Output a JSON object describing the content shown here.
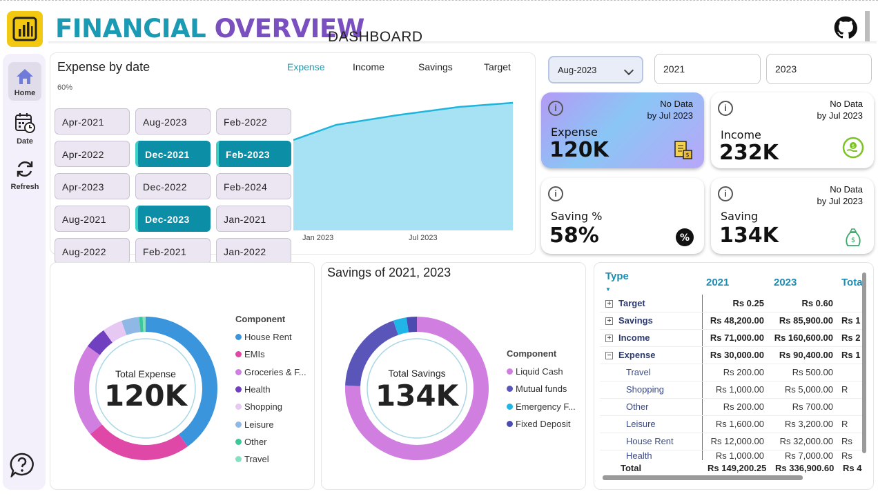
{
  "header": {
    "title_part1": "FINANCIAL",
    "title_part2": "OVERVIEW",
    "subtitle": "DASHBOARD"
  },
  "sidebar": {
    "items": [
      {
        "label": "Home",
        "icon": "home-icon"
      },
      {
        "label": "Date",
        "icon": "calendar-icon"
      },
      {
        "label": "Refresh",
        "icon": "refresh-icon"
      }
    ],
    "help_icon": "help-icon"
  },
  "expense_chart": {
    "title": "Expense by date",
    "tabs": [
      "Expense",
      "Income",
      "Savings",
      "Target"
    ],
    "active_tab": "Expense",
    "y_label": "60%",
    "x_ticks": [
      "Jan 2023",
      "Jul 2023"
    ]
  },
  "date_slicer": {
    "items": [
      {
        "label": "Apr-2021",
        "selected": false
      },
      {
        "label": "Aug-2023",
        "selected": false
      },
      {
        "label": "Feb-2022",
        "selected": false
      },
      {
        "label": "Apr-2022",
        "selected": false
      },
      {
        "label": "Dec-2021",
        "selected": true
      },
      {
        "label": "Feb-2023",
        "selected": true
      },
      {
        "label": "Apr-2023",
        "selected": false
      },
      {
        "label": "Dec-2022",
        "selected": false
      },
      {
        "label": "Feb-2024",
        "selected": false
      },
      {
        "label": "Aug-2021",
        "selected": false
      },
      {
        "label": "Dec-2023",
        "selected": true
      },
      {
        "label": "Jan-2021",
        "selected": false
      },
      {
        "label": "Aug-2022",
        "selected": false
      },
      {
        "label": "Feb-2021",
        "selected": false
      },
      {
        "label": "Jan-2022",
        "selected": false
      }
    ]
  },
  "filters": {
    "month": "Aug-2023",
    "year1": "2021",
    "year2": "2023"
  },
  "kpis": {
    "expense": {
      "label": "Expense",
      "value": "120K",
      "no_data": "No Data",
      "by": "by Jul 2023"
    },
    "income": {
      "label": "Income",
      "value": "232K",
      "no_data": "No Data",
      "by": "by Jul 2023"
    },
    "saving_pct": {
      "label": "Saving %",
      "value": "58%"
    },
    "saving": {
      "label": "Saving",
      "value": "134K",
      "no_data": "No Data",
      "by": "by Jul 2023"
    }
  },
  "expense_donut": {
    "center_label": "Total Expense",
    "center_value": "120K",
    "legend_title": "Component",
    "items": [
      {
        "label": "House Rent",
        "color": "#3a95dc"
      },
      {
        "label": "EMIs",
        "color": "#e048a8"
      },
      {
        "label": "Groceries & F...",
        "color": "#d07fe0"
      },
      {
        "label": "Health",
        "color": "#7040c0"
      },
      {
        "label": "Shopping",
        "color": "#e6c8f2"
      },
      {
        "label": "Leisure",
        "color": "#8fb8e6"
      },
      {
        "label": "Other",
        "color": "#3cc79a"
      },
      {
        "label": "Travel",
        "color": "#86e0c0"
      }
    ]
  },
  "savings_donut": {
    "title": "Savings of 2021, 2023",
    "center_label": "Total Savings",
    "center_value": "134K",
    "legend_title": "Component",
    "items": [
      {
        "label": "Liquid Cash",
        "color": "#d07fe0"
      },
      {
        "label": "Mutual funds",
        "color": "#5a55b8"
      },
      {
        "label": "Emergency F...",
        "color": "#1fb5e6"
      },
      {
        "label": "Fixed Deposit",
        "color": "#4b4bb0"
      }
    ]
  },
  "matrix": {
    "headers": [
      "Type",
      "2021",
      "2023",
      "Tota"
    ],
    "rows": [
      {
        "type": "Target",
        "expand": "+",
        "y2021": "Rs 0.25",
        "y2023": "Rs 0.60",
        "total": "",
        "level": "top"
      },
      {
        "type": "Savings",
        "expand": "+",
        "y2021": "Rs 48,200.00",
        "y2023": "Rs 85,900.00",
        "total": "Rs 1",
        "level": "top"
      },
      {
        "type": "Income",
        "expand": "+",
        "y2021": "Rs 71,000.00",
        "y2023": "Rs 160,600.00",
        "total": "Rs 2",
        "level": "top"
      },
      {
        "type": "Expense",
        "expand": "−",
        "y2021": "Rs 30,000.00",
        "y2023": "Rs 90,400.00",
        "total": "Rs 1",
        "level": "top"
      },
      {
        "type": "Travel",
        "expand": "",
        "y2021": "Rs 200.00",
        "y2023": "Rs 500.00",
        "total": "",
        "level": "sub"
      },
      {
        "type": "Shopping",
        "expand": "",
        "y2021": "Rs 1,000.00",
        "y2023": "Rs 5,000.00",
        "total": "R",
        "level": "sub"
      },
      {
        "type": "Other",
        "expand": "",
        "y2021": "Rs 200.00",
        "y2023": "Rs 700.00",
        "total": "",
        "level": "sub"
      },
      {
        "type": "Leisure",
        "expand": "",
        "y2021": "Rs 1,600.00",
        "y2023": "Rs 3,200.00",
        "total": "R",
        "level": "sub"
      },
      {
        "type": "House Rent",
        "expand": "",
        "y2021": "Rs 12,000.00",
        "y2023": "Rs 32,000.00",
        "total": "Rs",
        "level": "sub"
      },
      {
        "type": "Health",
        "expand": "",
        "y2021": "Rs 1,000.00",
        "y2023": "Rs 7,000.00",
        "total": "Rs",
        "level": "sub"
      }
    ],
    "total": {
      "label": "Total",
      "y2021": "Rs 149,200.25",
      "y2023": "Rs 336,900.60",
      "total": "Rs 4"
    }
  }
}
